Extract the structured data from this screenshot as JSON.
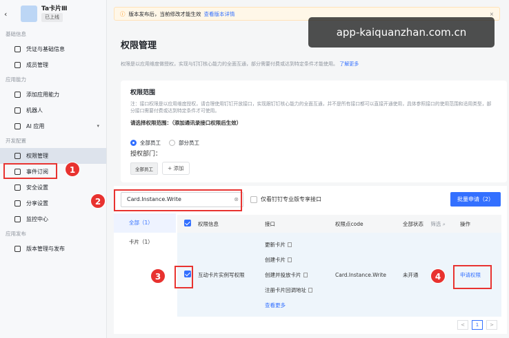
{
  "sidebar": {
    "back_icon": "chevron-left-icon",
    "app_name": "Ta卡片Ⅲ",
    "app_status": "已上线",
    "sections": [
      {
        "title": "基础信息",
        "items": [
          {
            "label": "凭证与基础信息",
            "icon": "shield-icon"
          },
          {
            "label": "成员管理",
            "icon": "user-icon"
          }
        ]
      },
      {
        "title": "应用能力",
        "items": [
          {
            "label": "添加应用能力",
            "icon": "grid-icon"
          },
          {
            "label": "机器人",
            "icon": "robot-icon"
          },
          {
            "label": "AI 应用",
            "icon": "ai-icon",
            "chevron": "▾"
          }
        ]
      },
      {
        "title": "开发配置",
        "items": [
          {
            "label": "权限管理",
            "icon": "lock-icon",
            "active": true
          },
          {
            "label": "事件订阅",
            "icon": "event-icon"
          },
          {
            "label": "安全设置",
            "icon": "security-icon"
          },
          {
            "label": "分享设置",
            "icon": "share-icon"
          },
          {
            "label": "监控中心",
            "icon": "monitor-icon"
          }
        ]
      },
      {
        "title": "应用发布",
        "items": [
          {
            "label": "版本管理与发布",
            "icon": "version-icon"
          }
        ]
      }
    ]
  },
  "notice": {
    "text": "版本发布后，当前修改才能生效",
    "link": "查看版本详情",
    "close": "×"
  },
  "watermark": "app-kaiquanzhan.com.cn",
  "page": {
    "title": "权限管理",
    "desc": "权限是以应用维度做授权，实现与钉钉核心能力的全面互通，部分需要付费或达到特定条件才能使用。",
    "desc_link": "了解更多"
  },
  "scope": {
    "title": "权限范围",
    "note": "注：接口权限是以应用维度授权，请合理使用钉钉开放接口，实现跟钉钉核心能力的全面互通，并不是所有接口都可以直接开通使用，具体参照接口的使用范围和适用类型，部分接口需要付费或达到特定条件才可使用。",
    "select_label": "请选择权限范围：（添加通讯录接口权限后生效）",
    "options": [
      "全部员工",
      "部分员工"
    ],
    "auth_label": "授权部门：",
    "dept_tag": "全部员工",
    "add_label": "+ 添加"
  },
  "search": {
    "value": "Card.Instance.Write",
    "clear": "⊗"
  },
  "filter_label": "仅看钉钉专业版专享接口",
  "batch_label": "批量申请（2）",
  "tabs": [
    "全部（1）",
    "卡片（1）"
  ],
  "table": {
    "headers": [
      "权限信息",
      "接口",
      "权限点code",
      "全部状态",
      "筛选",
      "操作"
    ],
    "row": {
      "name": "互动卡片实例写权限",
      "interfaces": [
        "更新卡片",
        "创建卡片",
        "创建并投放卡片",
        "注册卡片回调地址"
      ],
      "more": "查看更多",
      "code": "Card.Instance.Write",
      "status": "未开通",
      "action": "申请权限"
    }
  },
  "pager": {
    "prev": "<",
    "current": "1",
    "next": ">"
  },
  "steps": [
    "1",
    "2",
    "3",
    "4"
  ],
  "colors": {
    "accent": "#3370ff",
    "highlight": "#e8322f",
    "warning": "#ff8800"
  }
}
